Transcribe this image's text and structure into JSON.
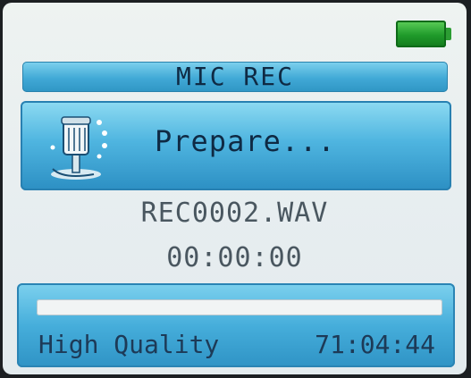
{
  "header": {
    "battery_icon": "battery-full-icon",
    "battery_level_percent": 100,
    "battery_color": "#1f9a2a"
  },
  "title_bar": {
    "title": "MIC REC"
  },
  "status_panel": {
    "icon": "microphone-icon",
    "status": "Prepare..."
  },
  "recording": {
    "file_name": "REC0002.WAV",
    "elapsed_time": "00:00:00"
  },
  "footer": {
    "progress_percent": 0,
    "quality": "High Quality",
    "remaining_time": "71:04:44"
  },
  "colors": {
    "accent": "#41a9d6",
    "text_dark": "#0f2a44",
    "text_gray": "#4a5760"
  }
}
